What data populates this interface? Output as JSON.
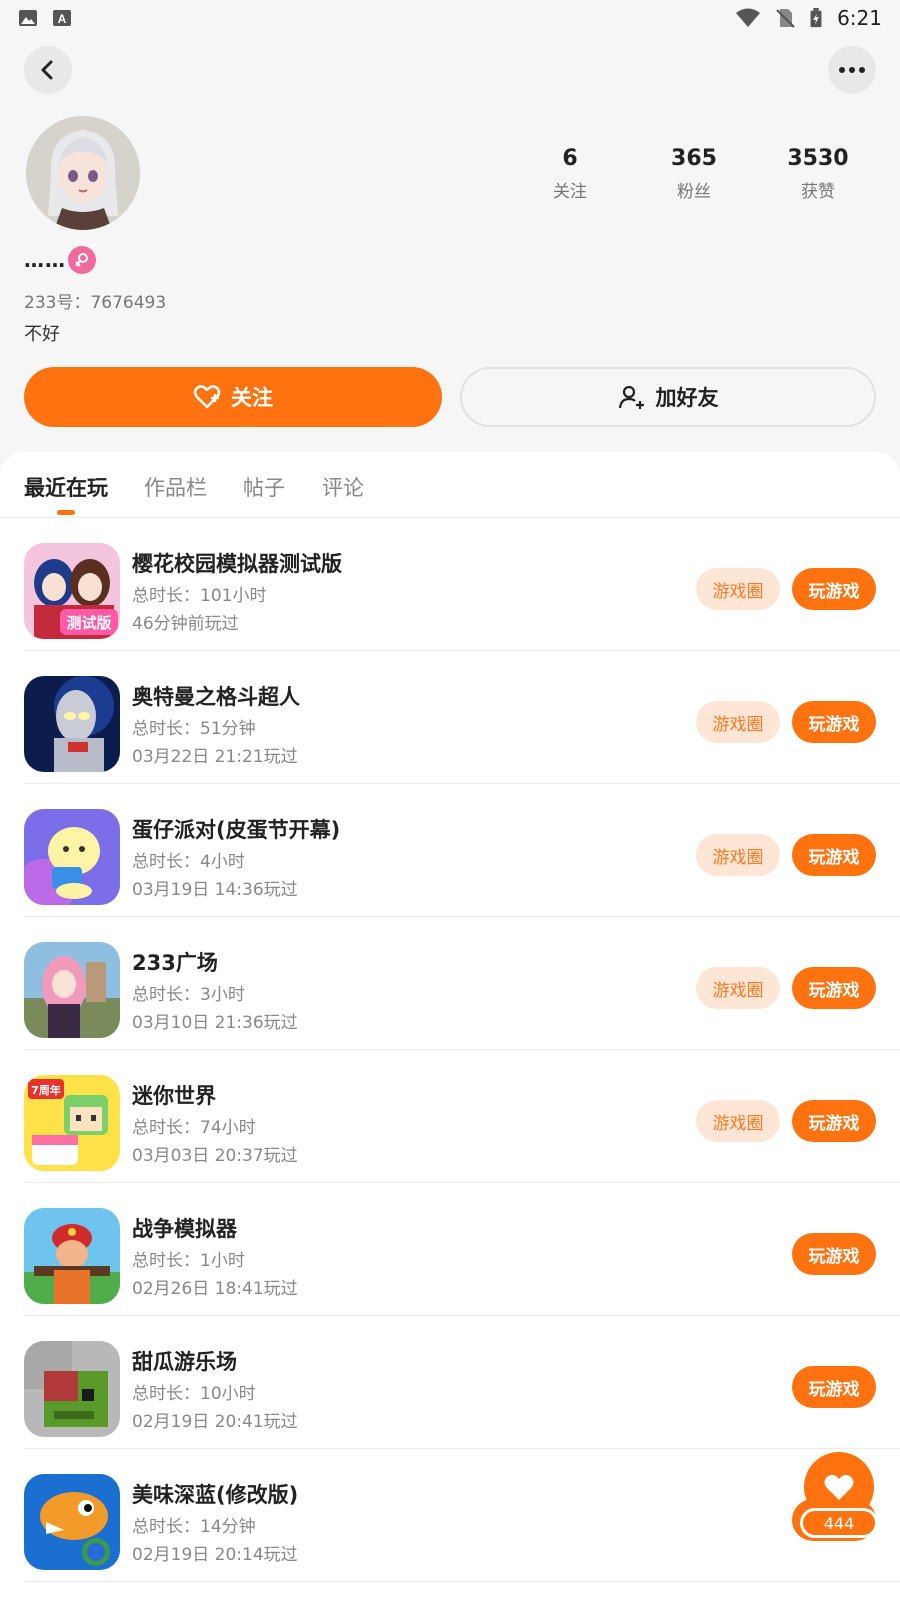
{
  "status_bar": {
    "time": "6:21",
    "icons": [
      "image-icon",
      "font-icon",
      "wifi-icon",
      "no-sim-icon",
      "battery-charging-icon"
    ]
  },
  "header": {
    "back_icon": "chevron-left-icon",
    "more_icon": "more-horizontal-icon"
  },
  "profile": {
    "username": "……",
    "gender": "female",
    "id_text": "233号：7676493",
    "bio": "不好",
    "stats": [
      {
        "value": "6",
        "label": "关注"
      },
      {
        "value": "365",
        "label": "粉丝"
      },
      {
        "value": "3530",
        "label": "获赞"
      }
    ]
  },
  "actions": {
    "follow_label": "关注",
    "add_friend_label": "加好友"
  },
  "tabs": [
    {
      "label": "最近在玩",
      "active": true
    },
    {
      "label": "作品栏",
      "active": false
    },
    {
      "label": "帖子",
      "active": false
    },
    {
      "label": "评论",
      "active": false
    }
  ],
  "buttons": {
    "circle_label": "游戏圈",
    "play_label": "玩游戏"
  },
  "games": [
    {
      "title": "樱花校园模拟器测试版",
      "duration": "总时长：101小时",
      "last_played": "46分钟前玩过",
      "has_circle": true,
      "icon_badge": "测试版"
    },
    {
      "title": "奥特曼之格斗超人",
      "duration": "总时长：51分钟",
      "last_played": "03月22日 21:21玩过",
      "has_circle": true
    },
    {
      "title": "蛋仔派对(皮蛋节开幕)",
      "duration": "总时长：4小时",
      "last_played": "03月19日 14:36玩过",
      "has_circle": true
    },
    {
      "title": "233广场",
      "duration": "总时长：3小时",
      "last_played": "03月10日 21:36玩过",
      "has_circle": true
    },
    {
      "title": "迷你世界",
      "duration": "总时长：74小时",
      "last_played": "03月03日 20:37玩过",
      "has_circle": true,
      "icon_badge": "7周年"
    },
    {
      "title": "战争模拟器",
      "duration": "总时长：1小时",
      "last_played": "02月26日 18:41玩过",
      "has_circle": false
    },
    {
      "title": "甜瓜游乐场",
      "duration": "总时长：10小时",
      "last_played": "02月19日 20:41玩过",
      "has_circle": false
    },
    {
      "title": "美味深蓝(修改版)",
      "duration": "总时长：14分钟",
      "last_played": "02月19日 20:14玩过",
      "has_circle": false
    }
  ],
  "like_fab": {
    "count": "444",
    "icon": "heart-icon"
  },
  "colors": {
    "accent": "#ff7210",
    "accent_light": "#fde6d6",
    "female": "#f06a9a"
  }
}
